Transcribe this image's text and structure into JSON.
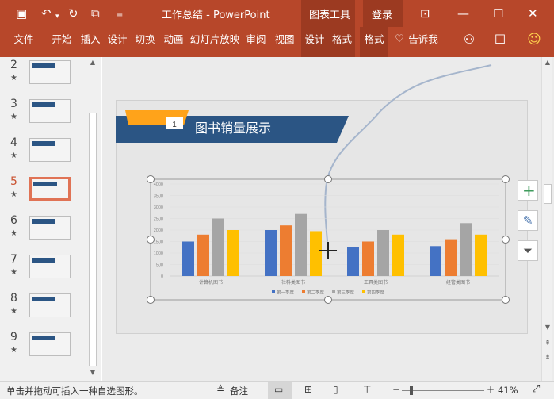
{
  "window": {
    "title": "工作总结  -  PowerPoint",
    "context_tab": "图表工具",
    "login": "登录"
  },
  "ribbon": {
    "tabs": [
      "文件",
      "开始",
      "插入",
      "设计",
      "切换",
      "动画",
      "幻灯片放映",
      "审阅",
      "视图",
      "设计",
      "格式",
      "格式"
    ],
    "tell_me": "告诉我"
  },
  "slides": [
    {
      "num": "2",
      "star": "★"
    },
    {
      "num": "3",
      "star": "★"
    },
    {
      "num": "4",
      "star": "★"
    },
    {
      "num": "5",
      "star": "★"
    },
    {
      "num": "6",
      "star": "★"
    },
    {
      "num": "7",
      "star": "★"
    },
    {
      "num": "8",
      "star": "★"
    },
    {
      "num": "9",
      "star": "★"
    }
  ],
  "slide": {
    "badge": "1",
    "title": "图书销量展示"
  },
  "chart_data": {
    "type": "bar",
    "categories": [
      "计算机图书",
      "社科类图书",
      "工具类图书",
      "经管类图书"
    ],
    "series": [
      {
        "name": "第一季度",
        "values": [
          1500,
          2000,
          1250,
          1300
        ],
        "color": "#4472c4"
      },
      {
        "name": "第二季度",
        "values": [
          1800,
          2200,
          1500,
          1600
        ],
        "color": "#ed7d31"
      },
      {
        "name": "第三季度",
        "values": [
          2500,
          2700,
          2000,
          2300
        ],
        "color": "#a5a5a5"
      },
      {
        "name": "第四季度",
        "values": [
          2000,
          1950,
          1800,
          1800
        ],
        "color": "#ffc000"
      }
    ],
    "yticks": [
      "0",
      "500",
      "1000",
      "1500",
      "2000",
      "2500",
      "3000",
      "3500",
      "4000"
    ],
    "ylim": [
      0,
      4000
    ],
    "legend": "bottom"
  },
  "status": {
    "hint": "单击并拖动可插入一种自选图形。",
    "notes": "备注",
    "zoom": "41%",
    "minus": "−",
    "plus": "+"
  },
  "colors": {
    "accent": "#b7472a",
    "slide_header": "#2b5584",
    "badge": "#ffa31a"
  }
}
